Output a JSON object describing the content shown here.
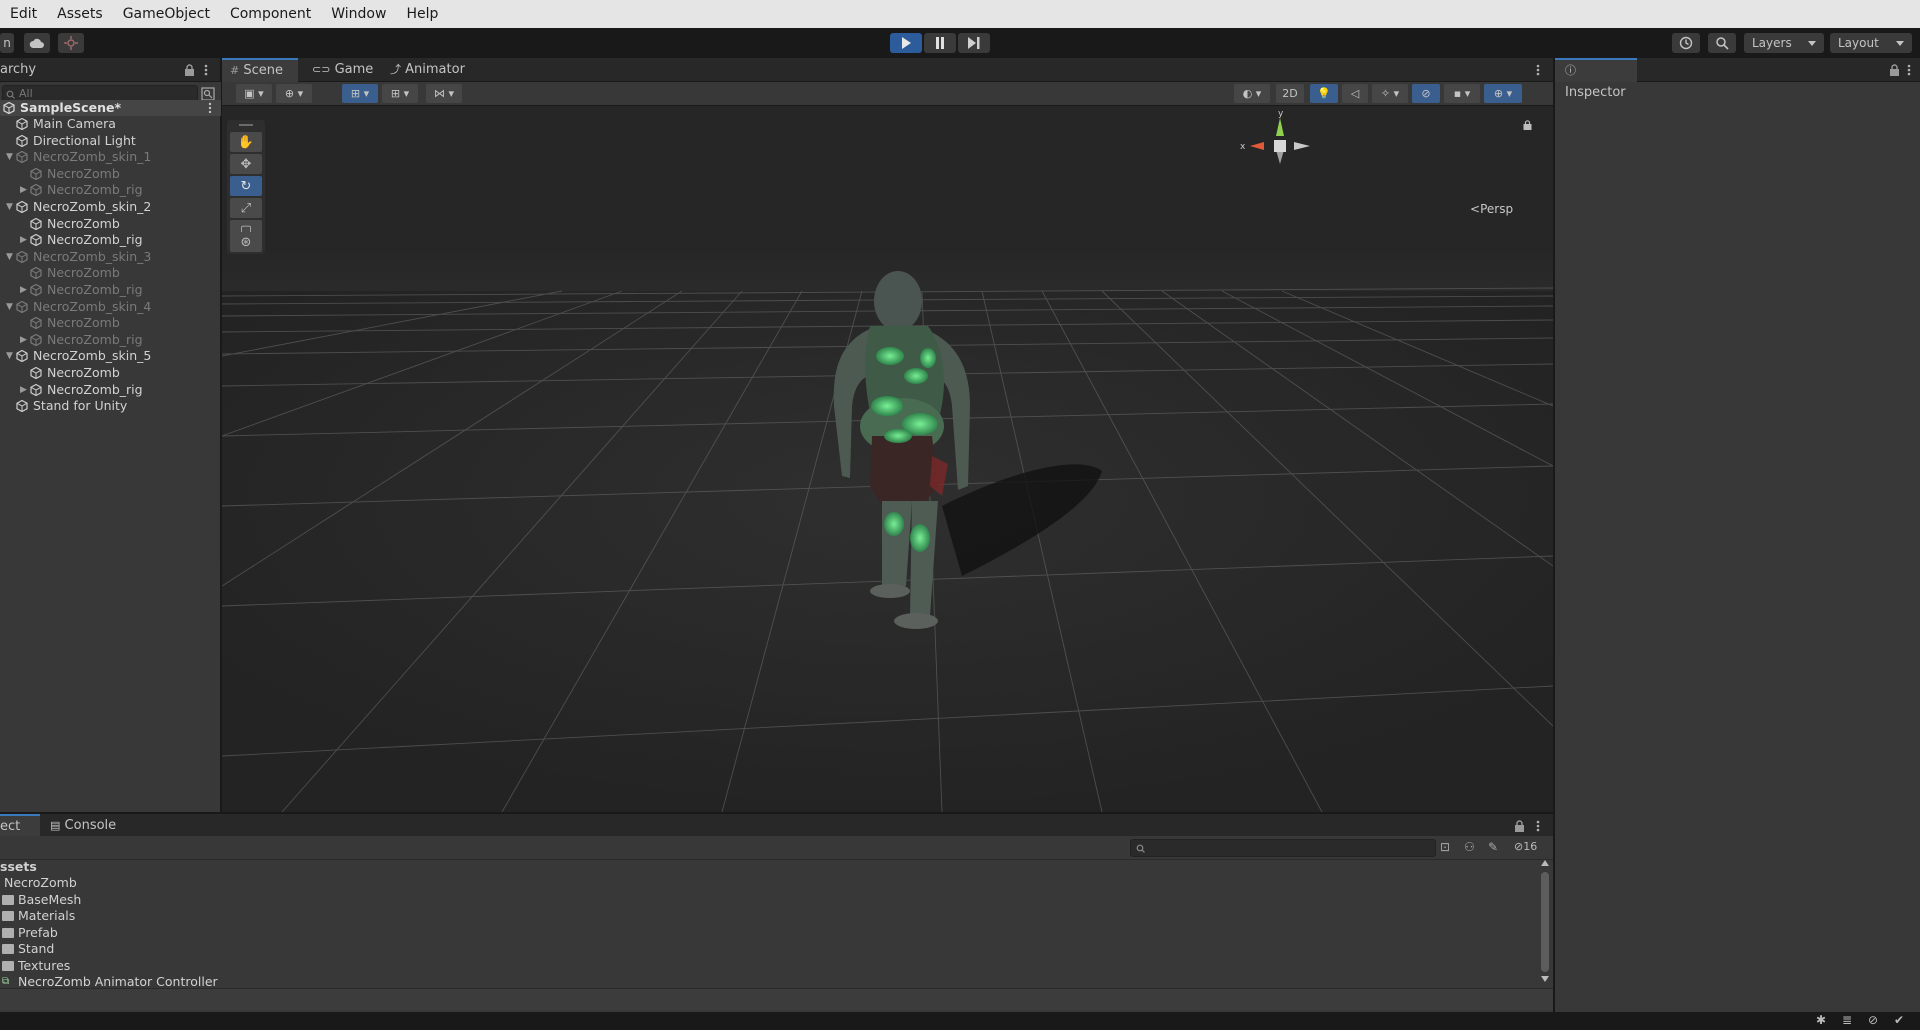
{
  "menu": [
    "Edit",
    "Assets",
    "GameObject",
    "Component",
    "Window",
    "Help"
  ],
  "toolbar": {
    "account_partial": "n",
    "layers_label": "Layers",
    "layout_label": "Layout"
  },
  "hierarchy": {
    "tab_label": "archy",
    "search_placeholder": "All",
    "scene_name": "SampleScene*",
    "items": [
      {
        "label": "Main Camera",
        "indent": 1,
        "dim": false,
        "arrow": ""
      },
      {
        "label": "Directional Light",
        "indent": 1,
        "dim": false,
        "arrow": ""
      },
      {
        "label": "NecroZomb_skin_1",
        "indent": 1,
        "dim": true,
        "arrow": "down"
      },
      {
        "label": "NecroZomb",
        "indent": 2,
        "dim": true,
        "arrow": ""
      },
      {
        "label": "NecroZomb_rig",
        "indent": 2,
        "dim": true,
        "arrow": "right"
      },
      {
        "label": "NecroZomb_skin_2",
        "indent": 1,
        "dim": false,
        "arrow": "down"
      },
      {
        "label": "NecroZomb",
        "indent": 2,
        "dim": false,
        "arrow": ""
      },
      {
        "label": "NecroZomb_rig",
        "indent": 2,
        "dim": false,
        "arrow": "right"
      },
      {
        "label": "NecroZomb_skin_3",
        "indent": 1,
        "dim": true,
        "arrow": "down"
      },
      {
        "label": "NecroZomb",
        "indent": 2,
        "dim": true,
        "arrow": ""
      },
      {
        "label": "NecroZomb_rig",
        "indent": 2,
        "dim": true,
        "arrow": "right"
      },
      {
        "label": "NecroZomb_skin_4",
        "indent": 1,
        "dim": true,
        "arrow": "down"
      },
      {
        "label": "NecroZomb",
        "indent": 2,
        "dim": true,
        "arrow": ""
      },
      {
        "label": "NecroZomb_rig",
        "indent": 2,
        "dim": true,
        "arrow": "right"
      },
      {
        "label": "NecroZomb_skin_5",
        "indent": 1,
        "dim": false,
        "arrow": "down"
      },
      {
        "label": "NecroZomb",
        "indent": 2,
        "dim": false,
        "arrow": ""
      },
      {
        "label": "NecroZomb_rig",
        "indent": 2,
        "dim": false,
        "arrow": "right"
      },
      {
        "label": "Stand for Unity",
        "indent": 1,
        "dim": false,
        "arrow": ""
      }
    ]
  },
  "scene": {
    "tabs": [
      "Scene",
      "Game",
      "Animator"
    ],
    "btn_2d": "2D",
    "gizmo_y": "y",
    "gizmo_x": "x",
    "persp_label": "Persp"
  },
  "inspector": {
    "tab_label": "Inspector"
  },
  "bottom": {
    "tabs": [
      "ect",
      "Console"
    ],
    "hidden_count": "16",
    "root_label": "ssets",
    "items": [
      {
        "label": "NecroZomb",
        "kind": "text"
      },
      {
        "label": "BaseMesh",
        "kind": "folder"
      },
      {
        "label": "Materials",
        "kind": "folder"
      },
      {
        "label": "Prefab",
        "kind": "folder"
      },
      {
        "label": "Stand",
        "kind": "folder"
      },
      {
        "label": "Textures",
        "kind": "folder"
      },
      {
        "label": "NecroZomb Animator Controller",
        "kind": "animator"
      }
    ]
  },
  "colors": {
    "accent": "#3a79bb",
    "play_active": "#2d5c9c",
    "zombie_glow": "#4fe07a"
  }
}
